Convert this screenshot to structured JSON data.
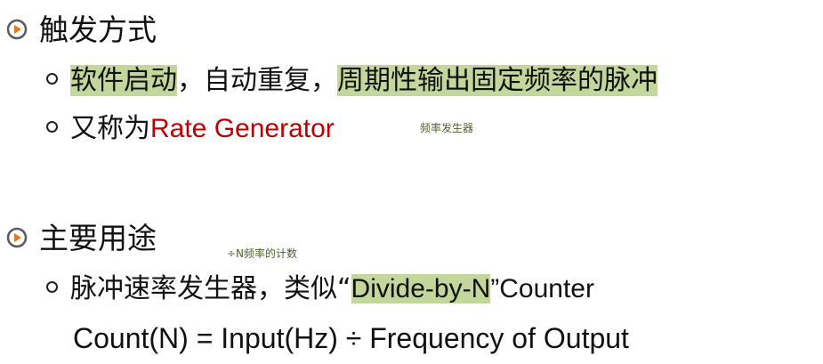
{
  "section1": {
    "heading": "触发方式",
    "item1": {
      "part1": "软件启动",
      "part2": "，自动重复，",
      "part3": "周期性输出固定频率的脉冲"
    },
    "item2": {
      "prefix": "又称为",
      "highlight": "Rate Generator",
      "note": "频率发生器"
    }
  },
  "section2": {
    "heading": "主要用途",
    "note": "÷N频率的计数",
    "item1": {
      "prefix": "脉冲速率发生器，类似“",
      "highlight": "Divide-by-N",
      "suffix": "”Counter"
    },
    "formula": "Count(N) = Input(Hz) ÷ Frequency of Output"
  },
  "colors": {
    "highlight": "#c3d69b",
    "accent_text": "#c00000",
    "icon": "#e07a20"
  }
}
